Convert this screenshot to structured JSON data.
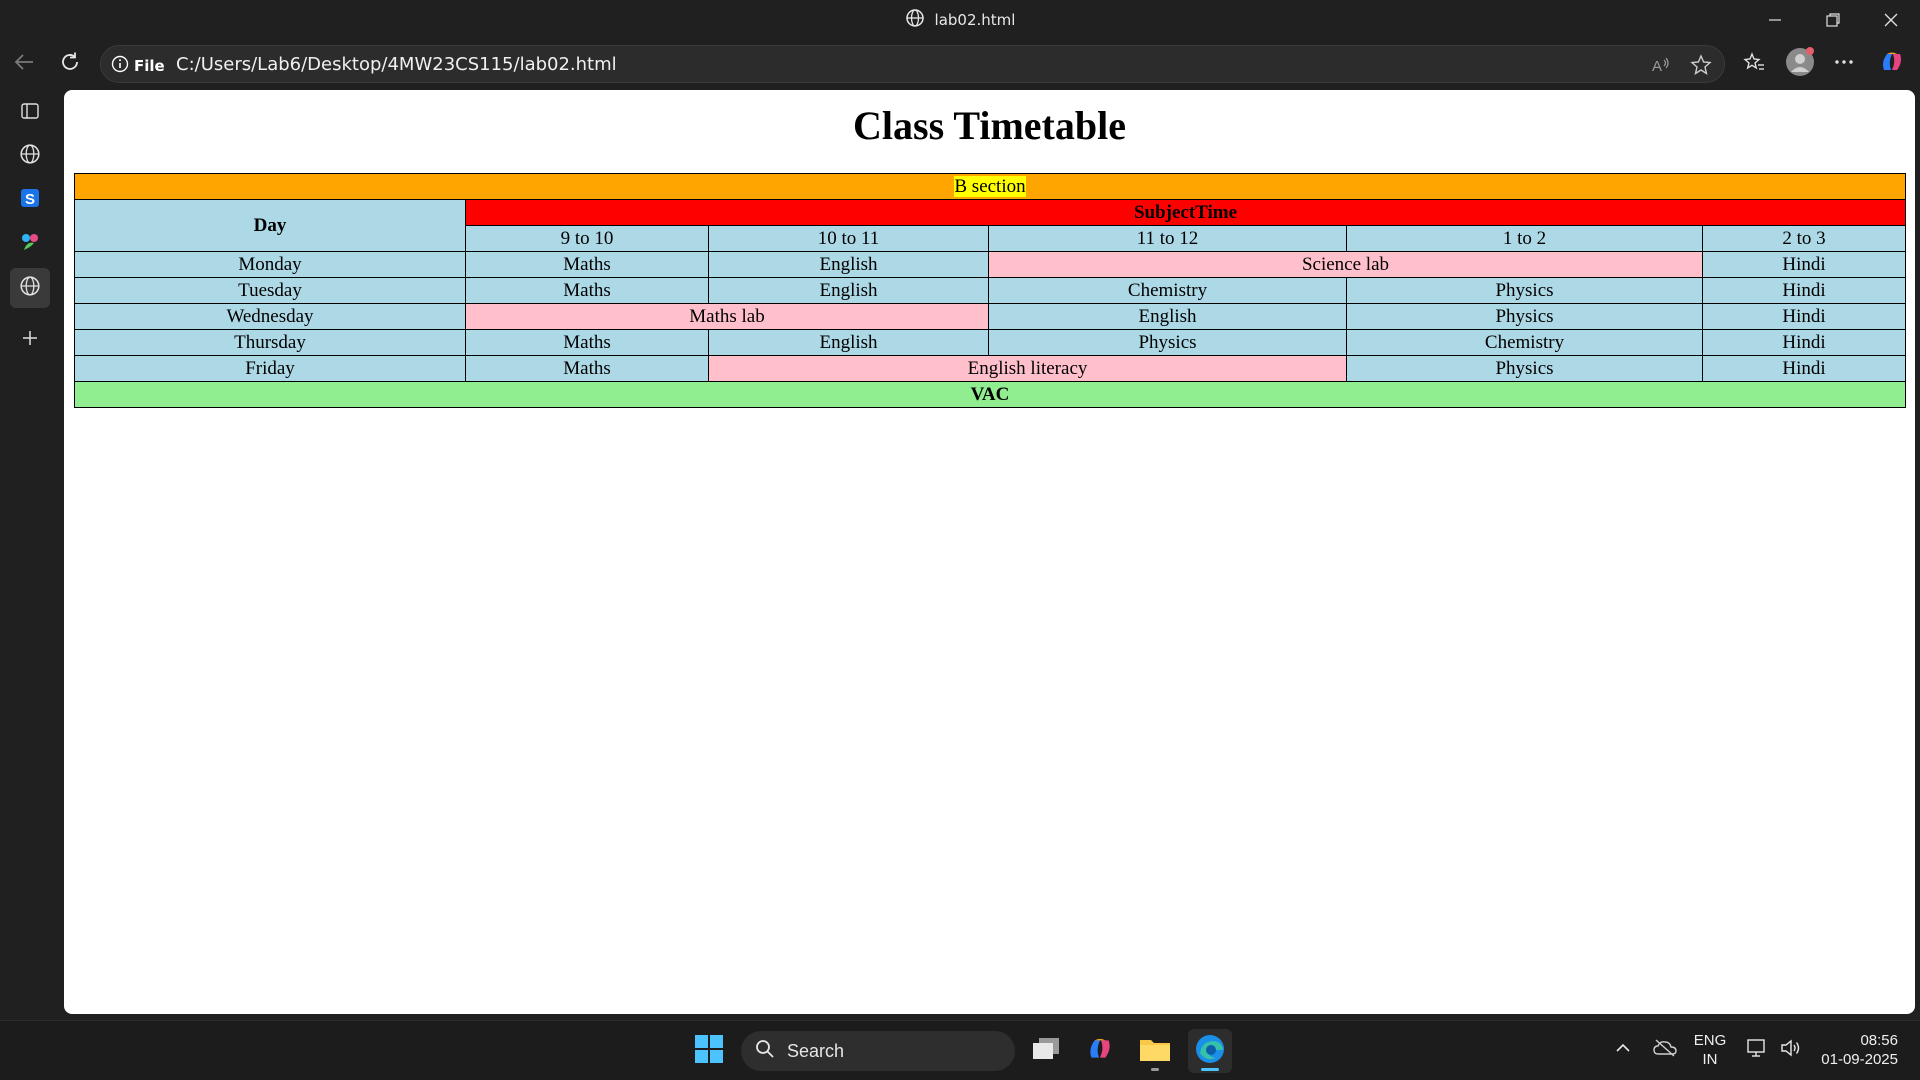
{
  "window": {
    "title": "lab02.html"
  },
  "address_bar": {
    "scheme_label": "File",
    "url": "C:/Users/Lab6/Desktop/4MW23CS115/lab02.html"
  },
  "page": {
    "heading": "Class Timetable",
    "section": "B section",
    "day_header": "Day",
    "subject_time_header": "SubjectTime",
    "time_slots": [
      "9 to 10",
      "10 to 11",
      "11 to 12",
      "1 to 2",
      "2 to 3"
    ],
    "rows": {
      "monday": {
        "day": "Monday",
        "c1": "Maths",
        "c2": "English",
        "c3": "Science lab",
        "c4": "Hindi"
      },
      "tuesday": {
        "day": "Tuesday",
        "c1": "Maths",
        "c2": "English",
        "c3": "Chemistry",
        "c4": "Physics",
        "c5": "Hindi"
      },
      "wednesday": {
        "day": "Wednesday",
        "c1": "Maths lab",
        "c2": "English",
        "c3": "Physics",
        "c4": "Hindi"
      },
      "thursday": {
        "day": "Thursday",
        "c1": "Maths",
        "c2": "English",
        "c3": "Physics",
        "c4": "Chemistry",
        "c5": "Hindi"
      },
      "friday": {
        "day": "Friday",
        "c1": "Maths",
        "c2": "English literacy",
        "c3": "Physics",
        "c4": "Hindi"
      }
    },
    "footer": "VAC",
    "colors": {
      "section_row": "#ffa500",
      "section_highlight": "#ffff00",
      "subject_time_row": "#ff0000",
      "cell": "#add8e6",
      "lab_cell": "#ffc0cb",
      "footer_row": "#90ee90"
    }
  },
  "taskbar": {
    "search_label": "Search",
    "language": "ENG",
    "region": "IN",
    "time": "08:56",
    "date": "01-09-2025"
  }
}
